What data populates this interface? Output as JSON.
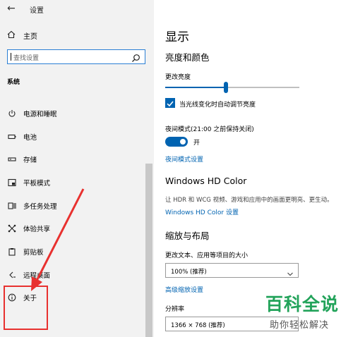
{
  "window": {
    "title": "设置"
  },
  "sidebar": {
    "home_label": "主页",
    "search_placeholder": "查找设置",
    "section_title": "系统",
    "items": [
      {
        "label": "电源和睡眠",
        "icon": "power-icon"
      },
      {
        "label": "电池",
        "icon": "battery-icon"
      },
      {
        "label": "存储",
        "icon": "storage-icon"
      },
      {
        "label": "平板模式",
        "icon": "tablet-mode-icon"
      },
      {
        "label": "多任务处理",
        "icon": "multitasking-icon"
      },
      {
        "label": "体验共享",
        "icon": "shared-experiences-icon"
      },
      {
        "label": "剪贴板",
        "icon": "clipboard-icon"
      },
      {
        "label": "远程桌面",
        "icon": "remote-desktop-icon"
      },
      {
        "label": "关于",
        "icon": "info-icon"
      }
    ]
  },
  "content": {
    "page_title": "显示",
    "brightness_section": "亮度和颜色",
    "brightness_label": "更改亮度",
    "brightness_value": 0.45,
    "auto_brightness_label": "当光线变化时自动调节亮度",
    "auto_brightness_checked": true,
    "night_mode_label": "夜间模式(21:00 之前保持关闭)",
    "night_mode_state": "开",
    "night_mode_link": "夜间模式设置",
    "hd_color_title": "Windows HD Color",
    "hd_color_desc": "让 HDR 和 WCG 视频、游戏和应用中的画面更明亮、更生动。",
    "hd_color_link": "Windows HD Color 设置",
    "scale_section": "缩放与布局",
    "scale_label": "更改文本、应用等项目的大小",
    "scale_value": "100% (推荐)",
    "advanced_scale_link": "高级缩放设置",
    "resolution_label": "分辨率",
    "resolution_value": "1366 × 768 (推荐)"
  },
  "watermark": {
    "title": "百科全说",
    "subtitle": "助你轻松解决"
  },
  "colors": {
    "accent": "#0063b1",
    "annotation": "#e8312f",
    "watermark": "#22a35a",
    "sidebar_bg": "#f2f2f2"
  }
}
